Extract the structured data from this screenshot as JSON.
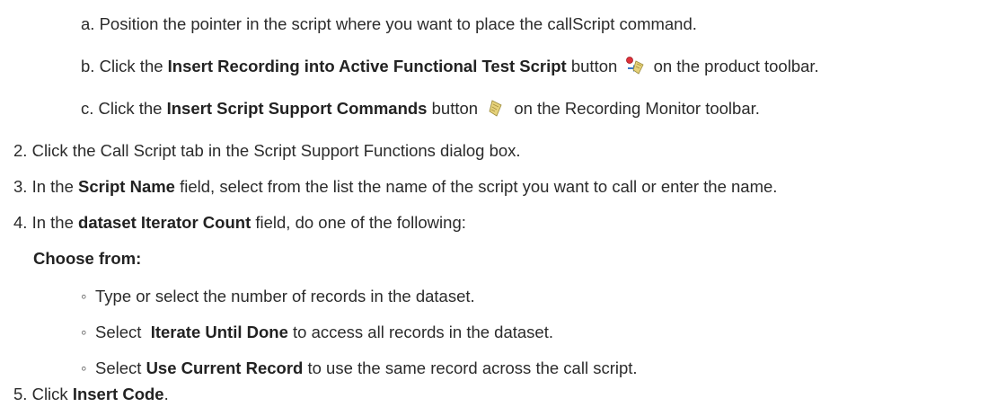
{
  "steps_sub": [
    {
      "marker": "a.",
      "text": "Position the pointer in the script where you want to place the callScript command."
    },
    {
      "marker": "b.",
      "pre": "Click the ",
      "bold": "Insert Recording into Active Functional Test Script",
      "mid": " button",
      "post": " on the product toolbar.",
      "icon": "insert-recording-icon"
    },
    {
      "marker": "c.",
      "pre": "Click the ",
      "bold": "Insert Script Support Commands",
      "mid": " button",
      "post": " on the Recording Monitor toolbar.",
      "icon": "script-support-commands-icon"
    }
  ],
  "step2": {
    "marker": "2.",
    "text": "Click the Call Script tab in the Script Support Functions dialog box."
  },
  "step3": {
    "marker": "3.",
    "pre": "In the ",
    "bold": "Script Name",
    "post": " field, select from the list the name of the script you want to call or enter the name."
  },
  "step4": {
    "marker": "4.",
    "pre": "In the ",
    "bold": "dataset Iterator Count",
    "post": " field, do one of the following:",
    "choose_label": "Choose from:",
    "options": [
      {
        "pre": "Type or select the number of records in the dataset.",
        "bold": "",
        "post": ""
      },
      {
        "pre": "Select  ",
        "bold": "Iterate Until Done",
        "post": " to access all records in the dataset."
      },
      {
        "pre": "Select ",
        "bold": "Use Current Record",
        "post": " to use the same record across the call script."
      }
    ]
  },
  "step5": {
    "marker": "5.",
    "pre": "Click ",
    "bold": "Insert Code",
    "post": "."
  },
  "bullet_glyph": "◦"
}
